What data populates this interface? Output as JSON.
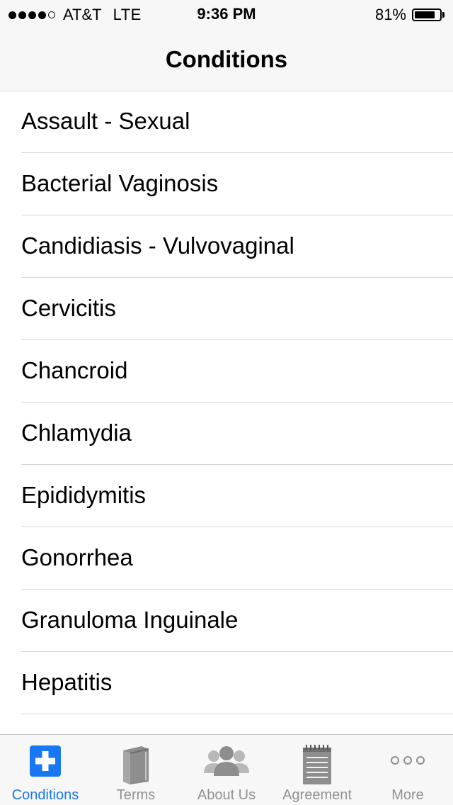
{
  "status_bar": {
    "carrier": "AT&T",
    "network": "LTE",
    "time": "9:36 PM",
    "battery_percent": "81%",
    "battery_level": 0.81,
    "signal_bars": 4,
    "signal_max": 5
  },
  "nav": {
    "title": "Conditions"
  },
  "conditions": [
    "Assault - Sexual",
    "Bacterial Vaginosis",
    "Candidiasis - Vulvovaginal",
    "Cervicitis",
    "Chancroid",
    "Chlamydia",
    "Epididymitis",
    "Gonorrhea",
    "Granuloma Inguinale",
    "Hepatitis"
  ],
  "tabs": [
    {
      "label": "Conditions",
      "icon": "medical-cross-icon",
      "active": true
    },
    {
      "label": "Terms",
      "icon": "book-icon",
      "active": false
    },
    {
      "label": "About Us",
      "icon": "people-icon",
      "active": false
    },
    {
      "label": "Agreement",
      "icon": "notepad-icon",
      "active": false
    },
    {
      "label": "More",
      "icon": "more-dots-icon",
      "active": false
    }
  ],
  "colors": {
    "accent": "#1877f2",
    "inactive": "#929292",
    "bar_bg": "#f7f7f7"
  }
}
